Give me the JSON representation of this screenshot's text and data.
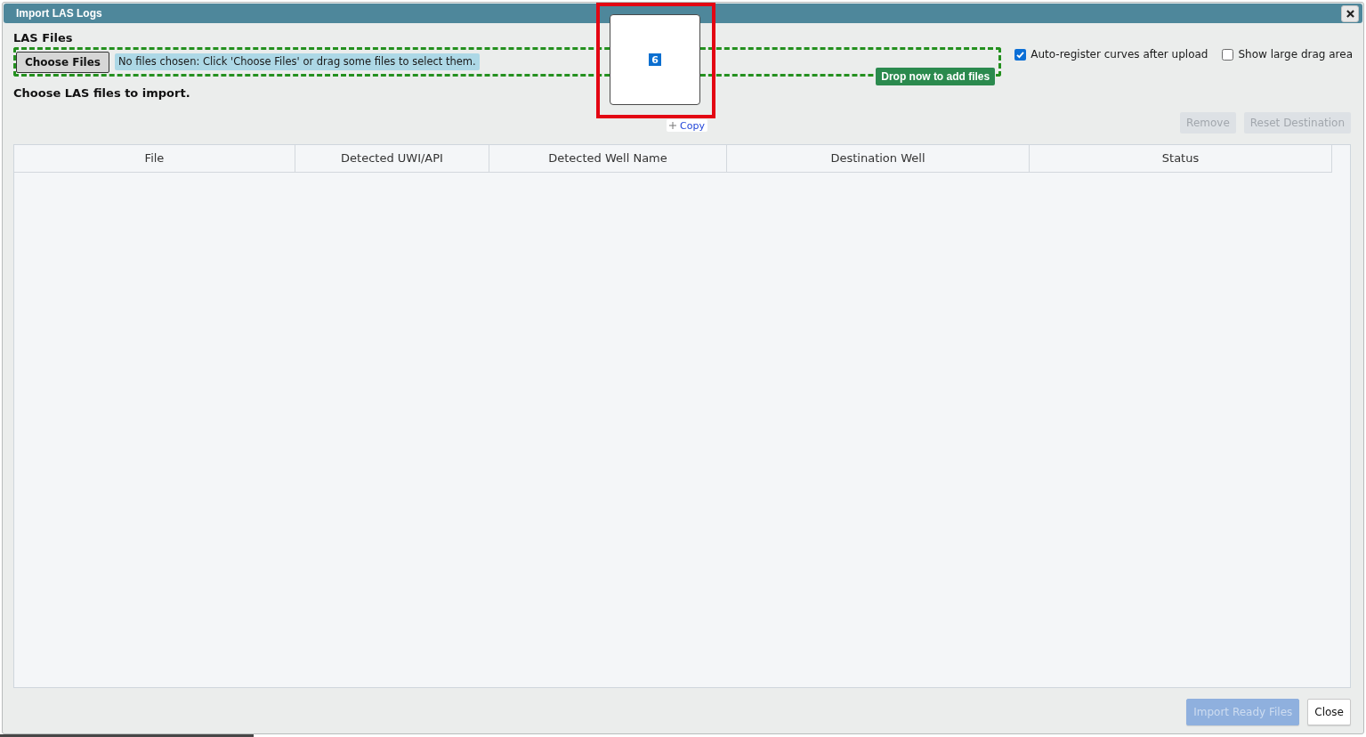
{
  "dialog": {
    "title": "Import LAS Logs"
  },
  "files_section": {
    "label": "LAS Files",
    "choose_button": "Choose Files",
    "file_status": "No files chosen: Click 'Choose Files' or drag some files to select them.",
    "drag_over": true,
    "drop_badge": "Drop now to add files"
  },
  "options": [
    {
      "label": "Auto-register curves after upload",
      "checked": true
    },
    {
      "label": "Show large drag area",
      "checked": false
    }
  ],
  "hint": "Choose LAS files to import.",
  "actions": [
    {
      "label": "Remove",
      "disabled": true
    },
    {
      "label": "Reset Destination",
      "disabled": true
    }
  ],
  "table": {
    "columns": [
      "File",
      "Detected UWI/API",
      "Detected Well Name",
      "Destination Well",
      "Status"
    ]
  },
  "footer_buttons": [
    {
      "label": "Import Ready Files",
      "kind": "primary",
      "disabled": true
    },
    {
      "label": "Close",
      "kind": "secondary",
      "disabled": false
    }
  ],
  "drag_preview": {
    "count": "6",
    "operation": "Copy",
    "highlighted": true
  }
}
